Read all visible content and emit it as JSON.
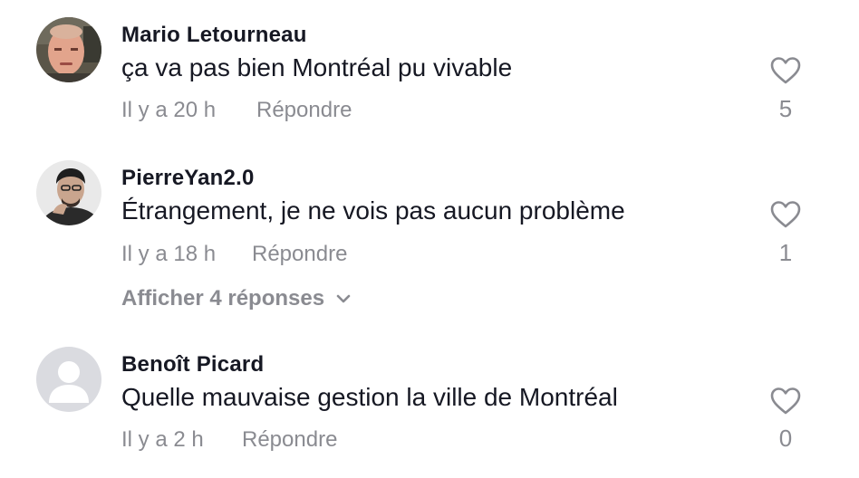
{
  "comments": [
    {
      "username": "Mario Letourneau",
      "text": "ça va pas bien Montréal pu vivable",
      "time": "Il y a 20 h",
      "reply_label": "Répondre",
      "likes": "5",
      "avatar_icon": "user-photo-avatar"
    },
    {
      "username": "PierreYan2.0",
      "text": "Étrangement, je ne vois pas aucun problème",
      "time": "Il y a 18 h",
      "reply_label": "Répondre",
      "likes": "1",
      "avatar_icon": "user-photo-avatar",
      "view_replies_label": "Afficher 4 réponses"
    },
    {
      "username": "Benoît Picard",
      "text": "Quelle mauvaise gestion la ville de Montréal",
      "time": "Il y a 2 h",
      "reply_label": "Répondre",
      "likes": "0",
      "avatar_icon": "default-avatar"
    }
  ],
  "colors": {
    "primary_text": "#161823",
    "secondary_text": "#8a8b91",
    "heart_outline": "#8a8b91",
    "default_avatar_bg": "#dadbe0"
  },
  "icons": {
    "like": "heart-outline-icon",
    "expand": "chevron-down-icon"
  }
}
